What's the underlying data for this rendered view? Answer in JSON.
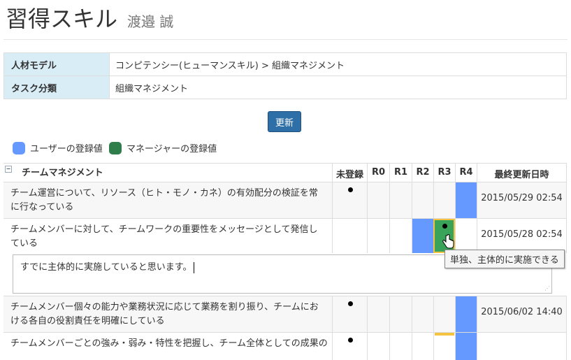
{
  "page": {
    "title": "習得スキル",
    "user_name": "渡邉 誠"
  },
  "info": {
    "model_label": "人材モデル",
    "model_value": "コンピテンシー(ヒューマンスキル) > 組織マネジメント",
    "task_label": "タスク分類",
    "task_value": "組織マネジメント"
  },
  "update_button": "更新",
  "legend": {
    "user": {
      "label": "ユーザーの登録値",
      "color": "#6699ff"
    },
    "manager": {
      "label": "マネージャーの登録値",
      "color": "#2e7d4a"
    }
  },
  "grid": {
    "columns": {
      "name": "チームマネジメント",
      "unregistered": "未登録",
      "r0": "R0",
      "r1": "R1",
      "r2": "R2",
      "r3": "R3",
      "r4": "R4",
      "updated": "最終更新日時"
    },
    "rows": [
      {
        "text": "チーム運営について、リソース（ヒト・モノ・カネ）の有効配分の検証を常に行なっている",
        "date": "2015/05/29 02:54"
      },
      {
        "text": "チームメンバーに対して、チームワークの重要性をメッセージとして発信している",
        "date": "2015/05/28 02:54"
      },
      {
        "text": "チームメンバー個々の能力や業務状況に応じて業務を割り振り、チームにおける各自の役割責任を明確にしている",
        "date": "2015/06/02 14:40"
      },
      {
        "text": "チームメンバーごとの強み・弱み・特性を把握し、チーム全体としての成果の"
      }
    ]
  },
  "comment": {
    "value": "すでに主体的に実施していると思います。"
  },
  "tooltip": "単独、主体的に実施できる"
}
